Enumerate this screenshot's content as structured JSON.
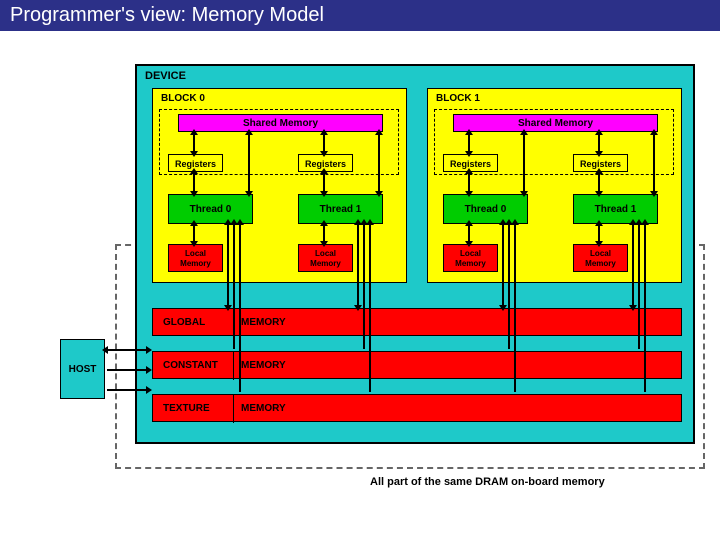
{
  "title": "Programmer's view: Memory Model",
  "device": {
    "label": "DEVICE"
  },
  "blocks": [
    {
      "label": "BLOCK 0",
      "shared": "Shared Memory",
      "registers": [
        "Registers",
        "Registers"
      ],
      "threads": [
        "Thread 0",
        "Thread 1"
      ],
      "locals": [
        "Local\nMemory",
        "Local\nMemory"
      ]
    },
    {
      "label": "BLOCK 1",
      "shared": "Shared Memory",
      "registers": [
        "Registers",
        "Registers"
      ],
      "threads": [
        "Thread 0",
        "Thread 1"
      ],
      "locals": [
        "Local\nMemory",
        "Local\nMemory"
      ]
    }
  ],
  "global_mem": {
    "w1": "GLOBAL",
    "w2": "MEMORY"
  },
  "constant_mem": {
    "w1": "CONSTANT",
    "w2": "MEMORY"
  },
  "texture_mem": {
    "w1": "TEXTURE",
    "w2": "MEMORY"
  },
  "host": "HOST",
  "dram_caption": "All part of the same DRAM on-board memory"
}
